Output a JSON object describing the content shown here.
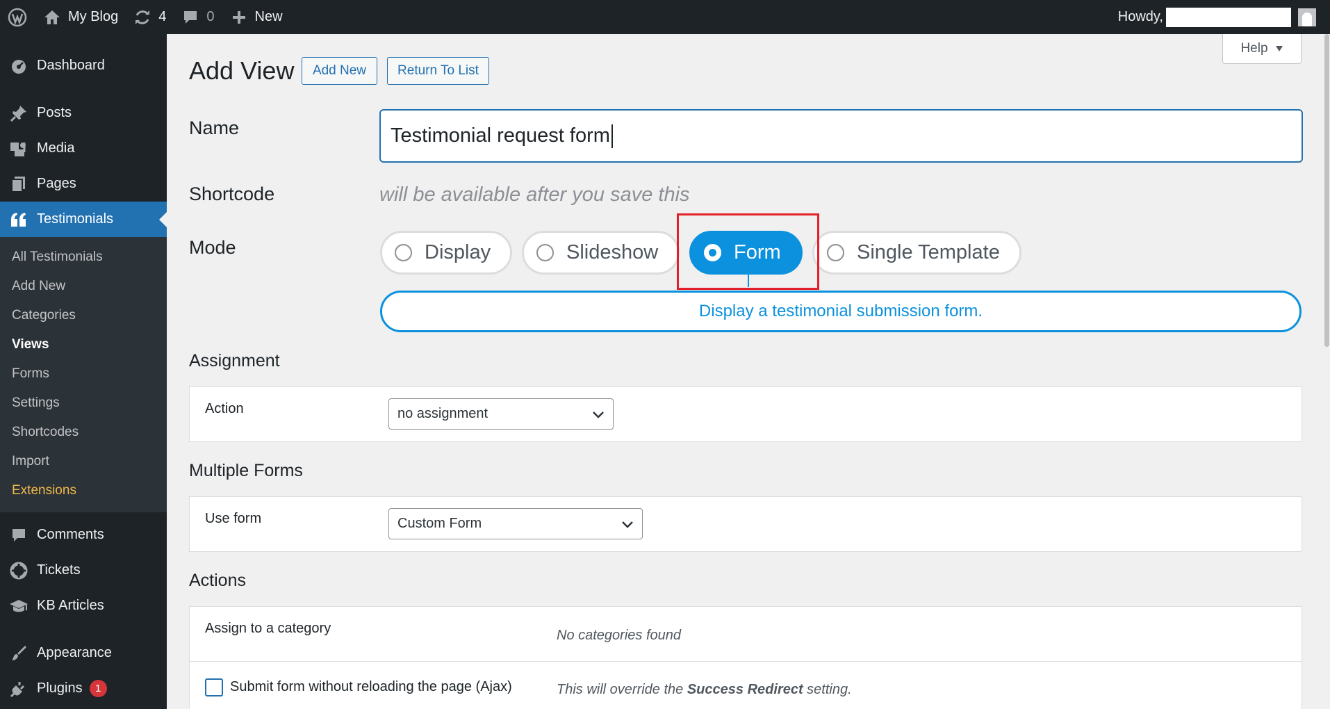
{
  "adminbar": {
    "site_name": "My Blog",
    "updates_count": "4",
    "comments_count": "0",
    "new_label": "New",
    "howdy": "Howdy,"
  },
  "sidebar": {
    "dashboard": "Dashboard",
    "posts": "Posts",
    "media": "Media",
    "pages": "Pages",
    "testimonials": "Testimonials",
    "submenu": [
      "All Testimonials",
      "Add New",
      "Categories",
      "Views",
      "Forms",
      "Settings",
      "Shortcodes",
      "Import",
      "Extensions"
    ],
    "comments": "Comments",
    "tickets": "Tickets",
    "kb_articles": "KB Articles",
    "appearance": "Appearance",
    "plugins": "Plugins",
    "plugins_badge": "1"
  },
  "help": {
    "label": "Help"
  },
  "page": {
    "title": "Add View",
    "add_new": "Add New",
    "return_to_list": "Return To List"
  },
  "form": {
    "name_label": "Name",
    "name_value": "Testimonial request form",
    "shortcode_label": "Shortcode",
    "shortcode_note": "will be available after you save this",
    "mode_label": "Mode",
    "modes": [
      "Display",
      "Slideshow",
      "Form",
      "Single Template"
    ],
    "selected_mode": "Form",
    "mode_description": "Display a testimonial submission form."
  },
  "assignment": {
    "title": "Assignment",
    "action_label": "Action",
    "action_value": "no assignment"
  },
  "multiple_forms": {
    "title": "Multiple Forms",
    "use_form_label": "Use form",
    "use_form_value": "Custom Form"
  },
  "actions": {
    "title": "Actions",
    "category_label": "Assign to a category",
    "category_note": "No categories found",
    "ajax_label": "Submit form without reloading the page (Ajax)",
    "ajax_note_prefix": "This will override the ",
    "ajax_note_bold": "Success Redirect",
    "ajax_note_suffix": " setting."
  }
}
